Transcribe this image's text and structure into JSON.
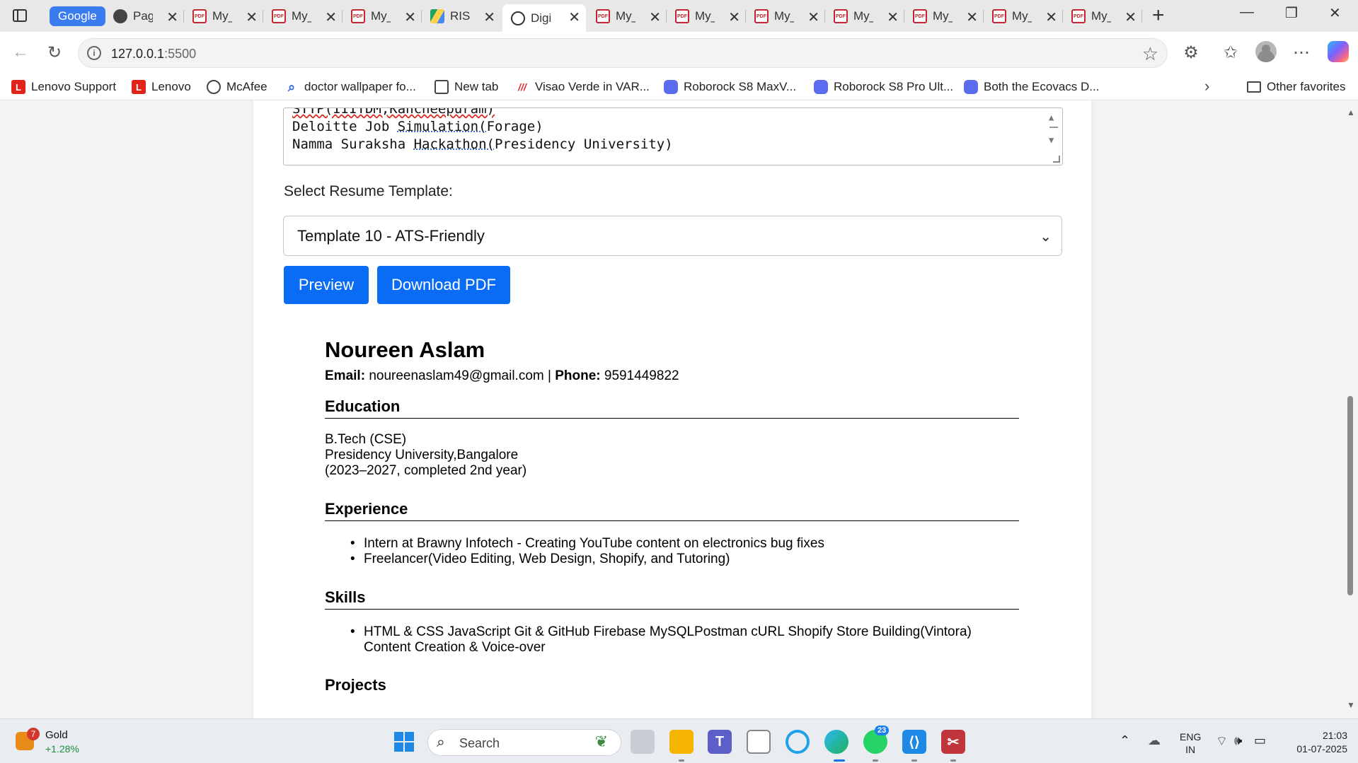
{
  "browser": {
    "tabs": [
      {
        "title": "Google",
        "kind": "group"
      },
      {
        "title": "Page",
        "icon": "github-icon"
      },
      {
        "title": "My_",
        "icon": "pdf-icon"
      },
      {
        "title": "My_",
        "icon": "pdf-icon"
      },
      {
        "title": "My_",
        "icon": "pdf-icon"
      },
      {
        "title": "RISE",
        "icon": "drive-icon"
      },
      {
        "title": "Digi",
        "icon": "globe-icon",
        "active": true
      },
      {
        "title": "My_",
        "icon": "pdf-icon"
      },
      {
        "title": "My_",
        "icon": "pdf-icon"
      },
      {
        "title": "My_",
        "icon": "pdf-icon"
      },
      {
        "title": "My_",
        "icon": "pdf-icon"
      },
      {
        "title": "My_",
        "icon": "pdf-icon"
      },
      {
        "title": "My_",
        "icon": "pdf-icon"
      },
      {
        "title": "My_",
        "icon": "pdf-icon"
      }
    ],
    "address": {
      "host": "127.0.0.1",
      "port": ":5500"
    },
    "favorites": [
      {
        "label": "Lenovo Support",
        "icon": "lenovo-icon"
      },
      {
        "label": "Lenovo",
        "icon": "lenovo-icon"
      },
      {
        "label": "McAfee",
        "icon": "globe-icon"
      },
      {
        "label": "doctor wallpaper fo...",
        "icon": "search-icon"
      },
      {
        "label": "New tab",
        "icon": "newtab-icon"
      },
      {
        "label": "Visao Verde in VAR...",
        "icon": "tiles-icon"
      },
      {
        "label": "Roborock S8 MaxV...",
        "icon": "roborock-icon"
      },
      {
        "label": "Roborock S8 Pro Ult...",
        "icon": "roborock-icon"
      },
      {
        "label": "Both the Ecovacs D...",
        "icon": "roborock-icon"
      }
    ],
    "other_favorites": "Other favorites"
  },
  "form": {
    "textarea_lines": {
      "partial": "STTP(IIITDM,Kancheepuram)",
      "line1_pre": "Deloitte Job ",
      "line1_mark": "Simulation(",
      "line1_post": "Forage)",
      "line2_pre": "Namma Suraksha ",
      "line2_mark": "Hackathon(",
      "line2_post": "Presidency University)"
    },
    "select_label": "Select Resume Template:",
    "selected_template": "Template 10 - ATS-Friendly",
    "preview_label": "Preview",
    "download_label": "Download PDF"
  },
  "resume": {
    "name": "Noureen Aslam",
    "email_label": "Email:",
    "email": "noureenaslam49@gmail.com",
    "separator": "|",
    "phone_label": "Phone:",
    "phone": "9591449822",
    "education_heading": "Education",
    "education_lines": [
      "B.Tech (CSE)",
      "Presidency University,Bangalore",
      "(2023–2027, completed 2nd year)"
    ],
    "experience_heading": "Experience",
    "experience_items": [
      "Intern at Brawny Infotech - Creating YouTube content on electronics bug fixes",
      "Freelancer(Video Editing, Web Design, Shopify, and Tutoring)"
    ],
    "skills_heading": "Skills",
    "skills_line1": "HTML & CSS JavaScript Git & GitHub Firebase MySQLPostman cURL Shopify Store Building(Vintora)",
    "skills_line2": "Content Creation & Voice-over",
    "projects_heading": "Projects"
  },
  "taskbar": {
    "widget_title": "Gold",
    "widget_change": "+1.28%",
    "widget_badge": "7",
    "search_placeholder": "Search",
    "whatsapp_badge": "23",
    "lang_top": "ENG",
    "lang_bottom": "IN",
    "time": "21:03",
    "date": "01-07-2025"
  },
  "colors": {
    "accent": "#0a6cf5",
    "group_tab": "#3a7bf0"
  }
}
